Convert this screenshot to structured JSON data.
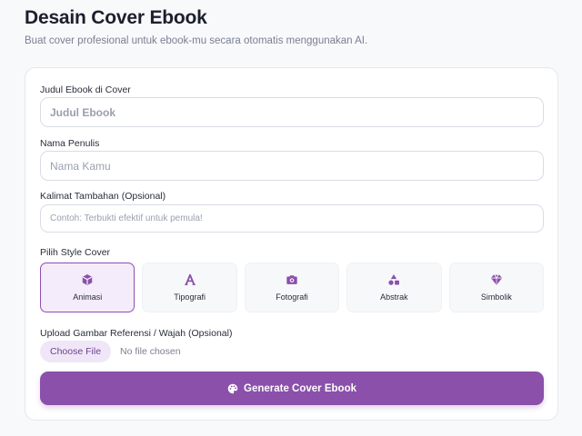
{
  "header": {
    "title": "Desain Cover Ebook",
    "subtitle": "Buat cover profesional untuk ebook-mu secara otomatis menggunakan AI."
  },
  "form": {
    "title_field": {
      "label": "Judul Ebook di Cover",
      "placeholder": "Judul Ebook",
      "value": ""
    },
    "author_field": {
      "label": "Nama Penulis",
      "placeholder": "Nama Kamu",
      "value": ""
    },
    "tagline_field": {
      "label": "Kalimat Tambahan (Opsional)",
      "placeholder": "Contoh: Terbukti efektif untuk pemula!",
      "value": ""
    },
    "style_section": {
      "label": "Pilih Style Cover",
      "selected": "Animasi",
      "options": [
        {
          "label": "Animasi",
          "icon": "cube-icon"
        },
        {
          "label": "Tipografi",
          "icon": "font-icon"
        },
        {
          "label": "Fotografi",
          "icon": "camera-icon"
        },
        {
          "label": "Abstrak",
          "icon": "shapes-icon"
        },
        {
          "label": "Simbolik",
          "icon": "gem-icon"
        }
      ]
    },
    "upload": {
      "label": "Upload Gambar Referensi / Wajah (Opsional)",
      "button_label": "Choose File",
      "status": "No file chosen"
    },
    "submit": {
      "label": "Generate Cover Ebook",
      "icon": "palette-icon"
    }
  },
  "colors": {
    "accent": "#8a50aa",
    "accent_light": "#f4ecfa",
    "text_dark": "#1c1f2e",
    "text_muted": "#7a7f93"
  }
}
